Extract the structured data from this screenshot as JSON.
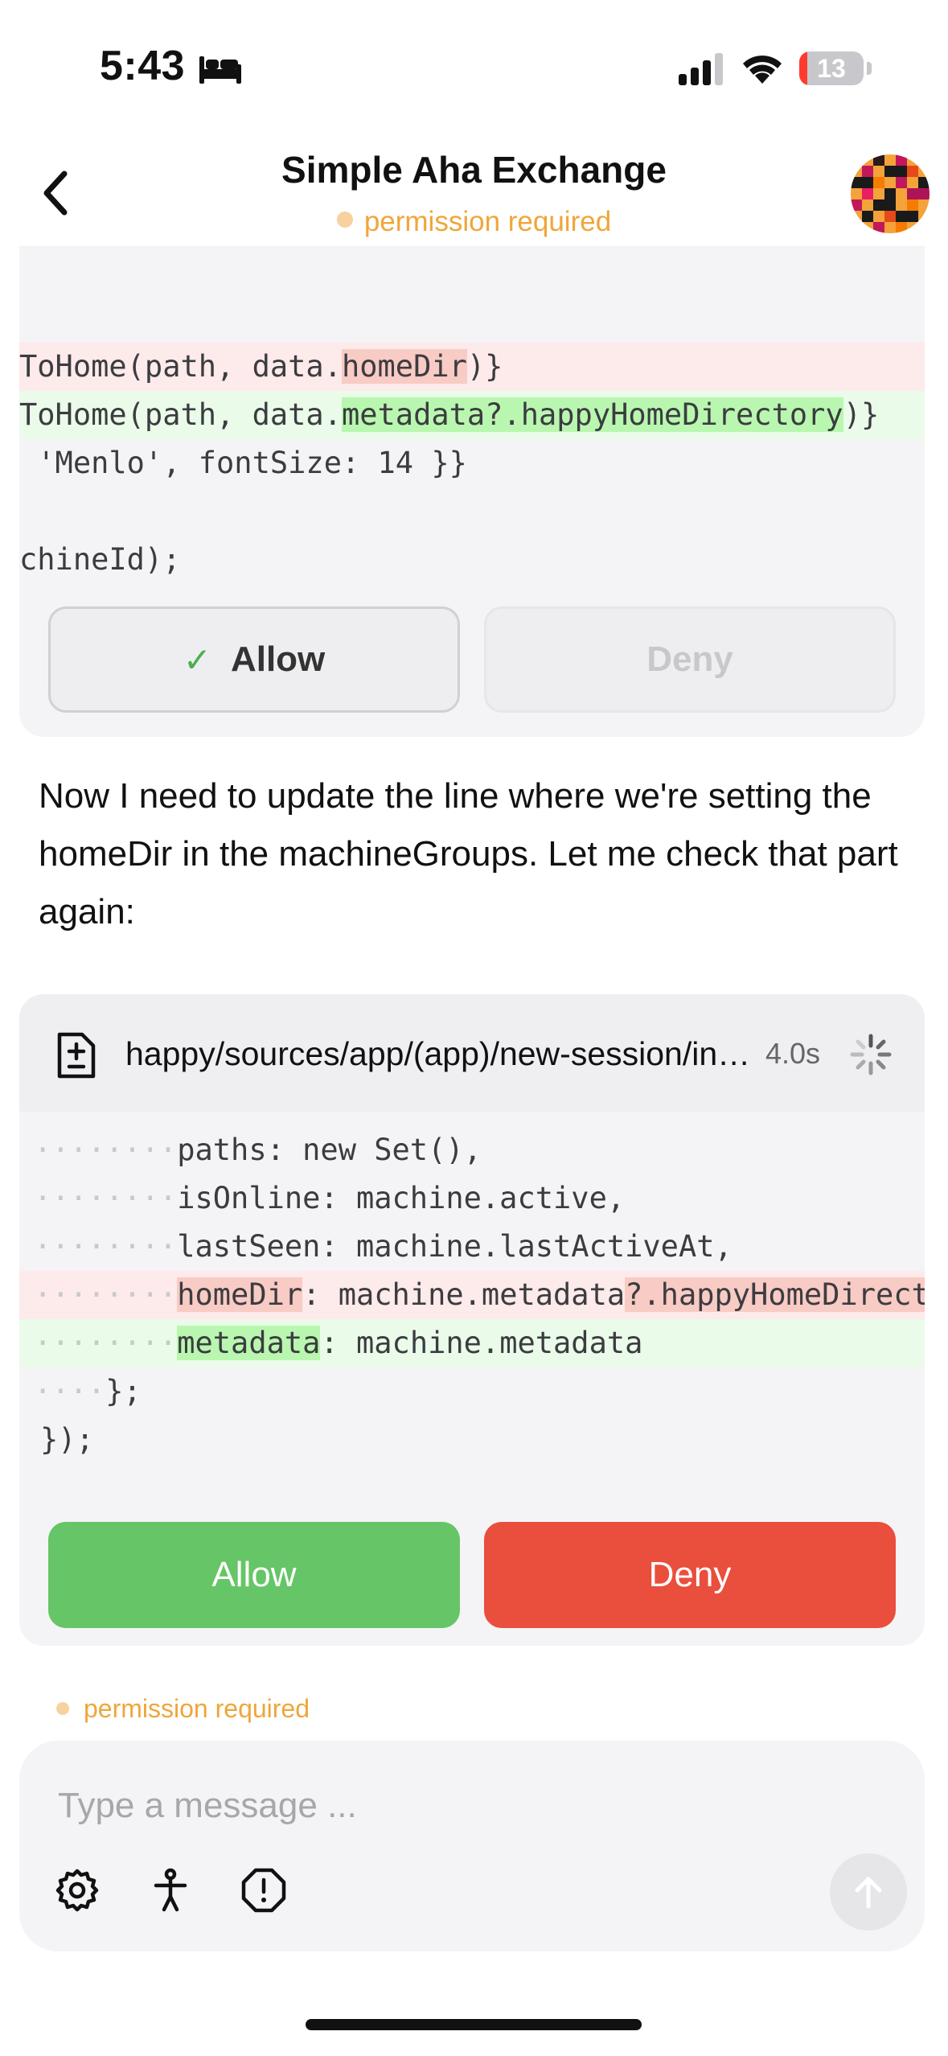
{
  "status_bar": {
    "time": "5:43",
    "battery_level": "13",
    "battery_fraction": 0.13,
    "icons": [
      "bed-icon",
      "signal-icon",
      "wifi-icon",
      "battery-icon"
    ]
  },
  "header": {
    "title": "Simple Aha Exchange",
    "status": "permission required",
    "back_icon": "chevron-left-icon",
    "avatar": "pixel-avatar"
  },
  "first_card": {
    "code_lines": [
      {
        "type": "context",
        "text": ""
      },
      {
        "type": "del",
        "pre": "ToHome(path, data.",
        "hl": "homeDir",
        "post": ")}"
      },
      {
        "type": "add",
        "pre": "ToHome(path, data.",
        "hl": "metadata?.happyHomeDirectory",
        "post": ")}"
      },
      {
        "type": "context",
        "text": " 'Menlo', fontSize: 14 }}"
      },
      {
        "type": "context",
        "text": ""
      },
      {
        "type": "context",
        "text": "chineId);"
      }
    ],
    "allow_label": "Allow",
    "deny_label": "Deny",
    "check_icon": "checkmark-icon"
  },
  "message": {
    "text": "Now I need to update the line where we're setting the homeDir in the machineGroups. Let me check that part again:"
  },
  "second_card": {
    "file_path": "happy/sources/app/(app)/new-session/index.tsx",
    "elapsed": "4.0s",
    "file_icon": "file-diff-icon",
    "spinner_icon": "spinner-icon",
    "code_lines": [
      {
        "type": "context",
        "dots": "········",
        "text": "paths: new Set(),"
      },
      {
        "type": "context",
        "dots": "········",
        "text": "isOnline: machine.active,"
      },
      {
        "type": "context",
        "dots": "········",
        "text": "lastSeen: machine.lastActiveAt,"
      },
      {
        "type": "del",
        "dots": "········",
        "hl1": "homeDir",
        "mid": ": machine.metadata",
        "hl2": "?.happyHomeDirectory"
      },
      {
        "type": "add",
        "dots": "········",
        "hl1": "metadata",
        "mid": ": machine.metadata",
        "hl2": ""
      },
      {
        "type": "context",
        "dots": "····",
        "text": "};"
      },
      {
        "type": "context",
        "dots": "",
        "text": "});"
      }
    ],
    "allow_label": "Allow",
    "deny_label": "Deny"
  },
  "footer_status": "permission required",
  "composer": {
    "placeholder": "Type a message ...",
    "tools": [
      "gear-icon",
      "accessibility-icon",
      "alert-octagon-icon"
    ],
    "send_icon": "arrow-up-icon"
  },
  "colors": {
    "accent_orange": "#efa63a",
    "allow_green": "#66c566",
    "deny_red": "#ea4e3d",
    "diff_del_bg": "#fdeaea",
    "diff_add_bg": "#eafbea",
    "diff_del_hl": "#f8cbc4",
    "diff_add_hl": "#b9f7b0"
  }
}
